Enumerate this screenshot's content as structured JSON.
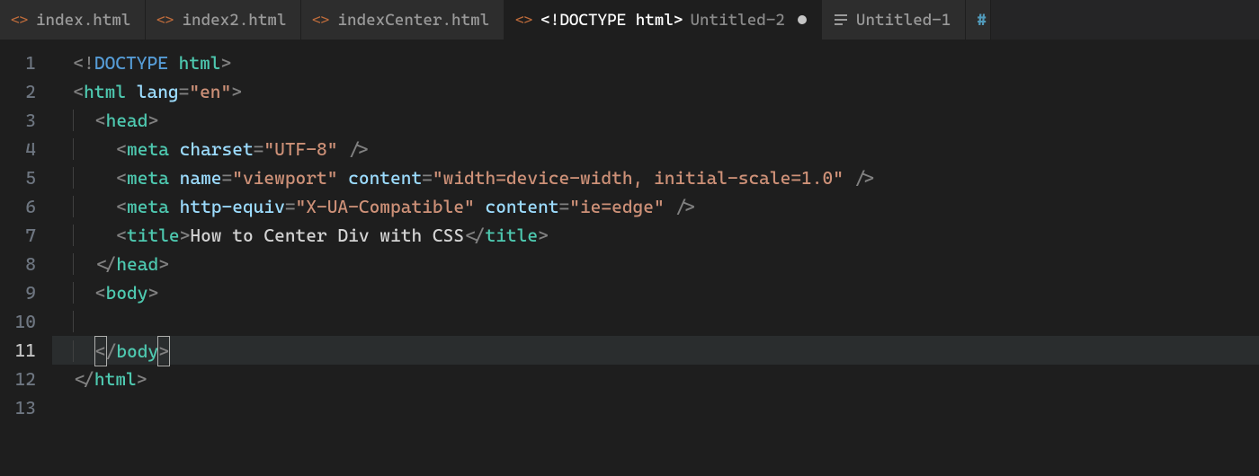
{
  "tabs": [
    {
      "label": "index.html",
      "type": "html"
    },
    {
      "label": "index2.html",
      "type": "html"
    },
    {
      "label": "indexCenter.html",
      "type": "html"
    },
    {
      "label": "<!DOCTYPE html>",
      "sub": "Untitled-2",
      "type": "html",
      "active": true,
      "modified": true
    },
    {
      "label": "Untitled-1",
      "type": "text"
    },
    {
      "label": "#",
      "type": "hash",
      "partial": true
    }
  ],
  "gutter": {
    "lines": [
      "1",
      "2",
      "3",
      "4",
      "5",
      "6",
      "7",
      "8",
      "9",
      "10",
      "11",
      "12",
      "13"
    ],
    "current": 11
  },
  "code": {
    "doctype": {
      "open": "<!",
      "word1": "DOCTYPE",
      "word2": "html",
      "close": ">"
    },
    "htmlOpen": {
      "lt": "<",
      "tag": "html",
      "attr": "lang",
      "eq": "=",
      "val": "\"en\"",
      "gt": ">"
    },
    "headOpen": {
      "lt": "<",
      "tag": "head",
      "gt": ">"
    },
    "meta1": {
      "lt": "<",
      "tag": "meta",
      "attr1": "charset",
      "eq": "=",
      "val1": "\"UTF-8\"",
      "slashgt": " />"
    },
    "meta2": {
      "lt": "<",
      "tag": "meta",
      "attr1": "name",
      "val1": "\"viewport\"",
      "attr2": "content",
      "val2": "\"width=device-width, initial-scale=1.0\"",
      "slashgt": " />"
    },
    "meta3": {
      "lt": "<",
      "tag": "meta",
      "attr1": "http-equiv",
      "val1": "\"X-UA-Compatible\"",
      "attr2": "content",
      "val2": "\"ie=edge\"",
      "slashgt": " />"
    },
    "title": {
      "lt": "<",
      "tag": "title",
      "gt": ">",
      "text": "How to Center Div with CSS",
      "lt2": "</",
      "gt2": ">"
    },
    "headClose": {
      "lt": "</",
      "tag": "head",
      "gt": ">"
    },
    "bodyOpen": {
      "lt": "<",
      "tag": "body",
      "gt": ">"
    },
    "bodyClose": {
      "lt": "</",
      "tag": "body",
      "gt": ">"
    },
    "htmlClose": {
      "lt": "</",
      "tag": "html",
      "gt": ">"
    }
  }
}
